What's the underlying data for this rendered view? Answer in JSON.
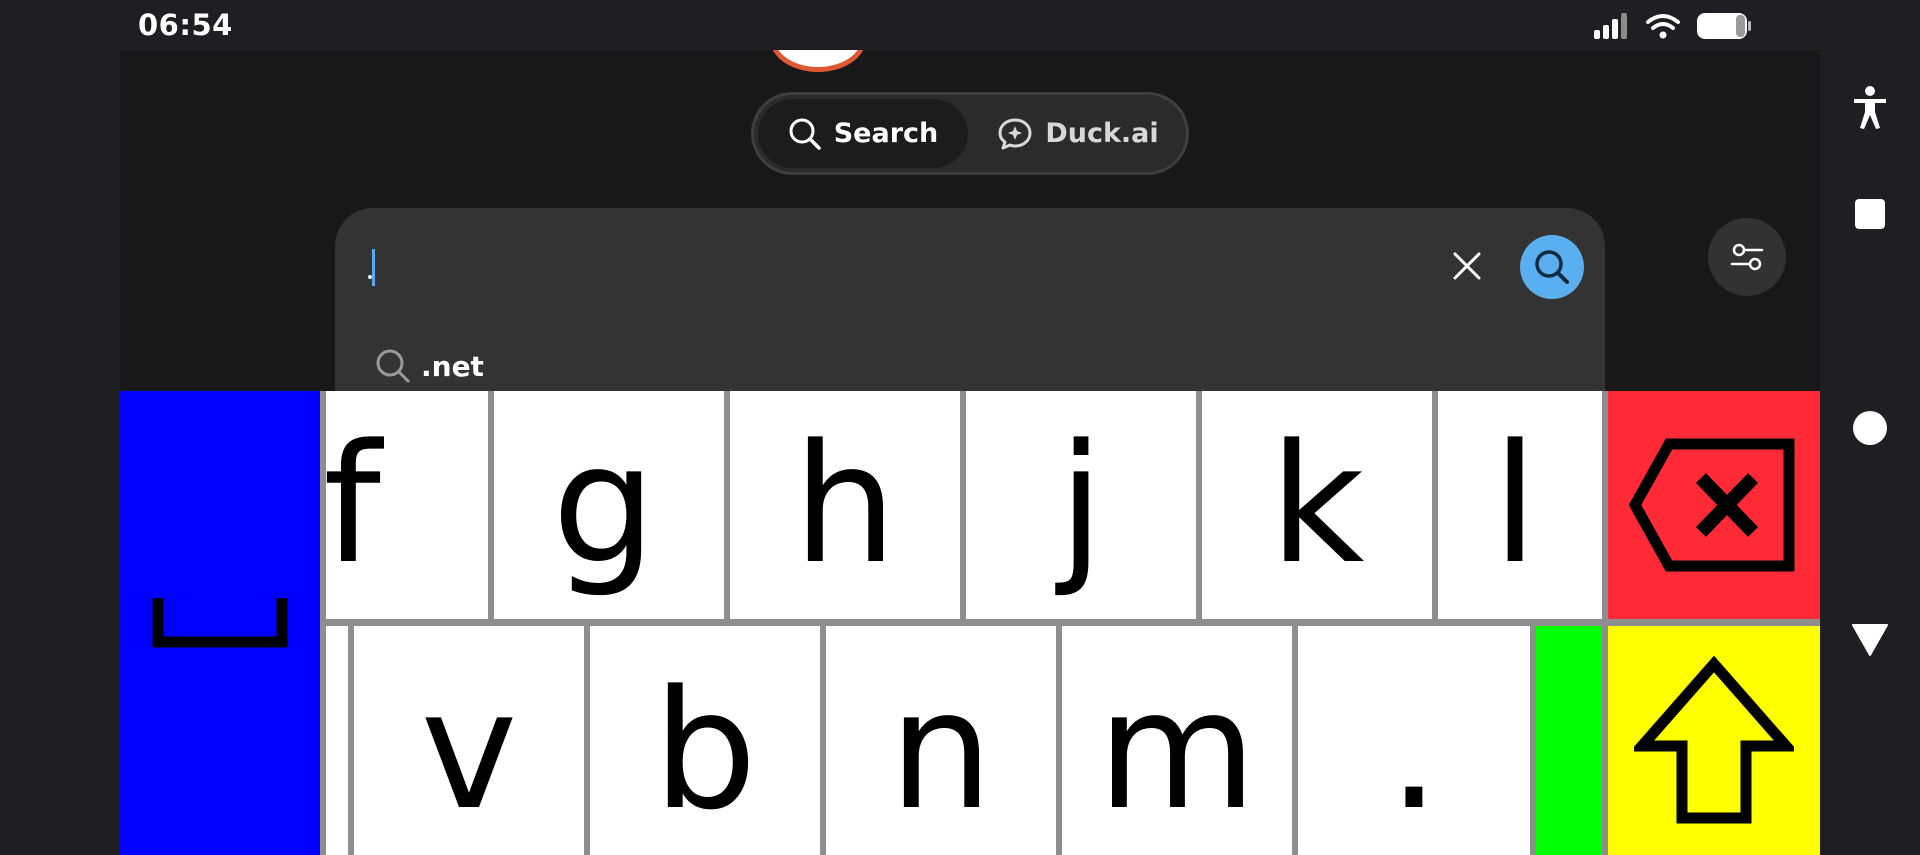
{
  "status_bar": {
    "time": "06:54",
    "icons": [
      "signal-icon",
      "wifi-icon",
      "battery-icon"
    ]
  },
  "mode_toggle": {
    "search_label": "Search",
    "duck_label": "Duck.ai",
    "selected": "Search"
  },
  "search": {
    "query": "",
    "suggestion": ".net"
  },
  "keyboard": {
    "row1": [
      "f",
      "g",
      "h",
      "j",
      "k",
      "l"
    ],
    "row2": [
      "v",
      "b",
      "n",
      "m",
      "."
    ],
    "space_icon": "space-bar-icon",
    "backspace_icon": "backspace-icon",
    "shift_icon": "shift-arrow-icon"
  },
  "nav_bar": {
    "icons": [
      "accessibility-icon",
      "recents-square-icon",
      "home-circle-icon",
      "back-triangle-icon"
    ]
  },
  "colors": {
    "space_key": "#0000ff",
    "backspace_key": "#ff2a36",
    "shift_key": "#ffff00",
    "green_key": "#00ff00",
    "search_button": "#5aaff0",
    "brand": "#de5833"
  }
}
